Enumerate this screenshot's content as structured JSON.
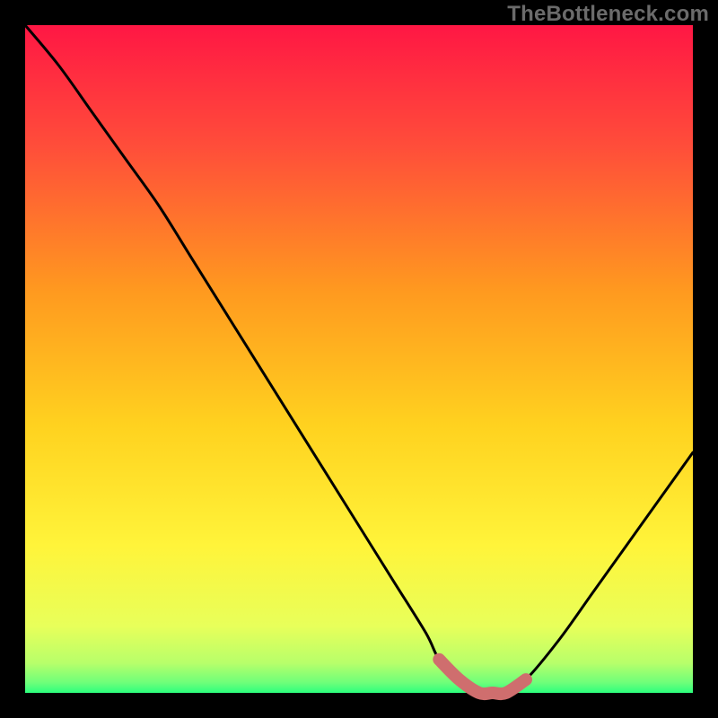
{
  "watermark": {
    "text": "TheBottleneck.com"
  },
  "chart_data": {
    "type": "line",
    "title": "",
    "xlabel": "",
    "ylabel": "",
    "xlim": [
      0,
      100
    ],
    "ylim": [
      0,
      100
    ],
    "grid": false,
    "legend": "none",
    "background": {
      "type": "vertical-gradient",
      "stops": [
        {
          "pos": 0.0,
          "color": "#ff1744"
        },
        {
          "pos": 0.18,
          "color": "#ff4d3a"
        },
        {
          "pos": 0.4,
          "color": "#ff9a1f"
        },
        {
          "pos": 0.6,
          "color": "#ffd21f"
        },
        {
          "pos": 0.78,
          "color": "#fff43a"
        },
        {
          "pos": 0.9,
          "color": "#e8ff5a"
        },
        {
          "pos": 0.955,
          "color": "#b8ff6a"
        },
        {
          "pos": 0.985,
          "color": "#6dff7a"
        },
        {
          "pos": 1.0,
          "color": "#2bff7d"
        }
      ]
    },
    "series": [
      {
        "name": "bottleneck-curve",
        "x": [
          0,
          5,
          10,
          15,
          20,
          25,
          30,
          35,
          40,
          45,
          50,
          55,
          60,
          62,
          65,
          68,
          70,
          72,
          75,
          80,
          85,
          90,
          95,
          100
        ],
        "y": [
          100,
          94,
          87,
          80,
          73,
          65,
          57,
          49,
          41,
          33,
          25,
          17,
          9,
          5,
          2,
          0,
          0,
          0,
          2,
          8,
          15,
          22,
          29,
          36
        ]
      }
    ],
    "highlight": {
      "name": "optimal-range",
      "color": "#cf6e6e",
      "x": [
        62,
        65,
        68,
        70,
        72,
        75
      ],
      "y": [
        5,
        2,
        0,
        0,
        0,
        2
      ]
    }
  }
}
